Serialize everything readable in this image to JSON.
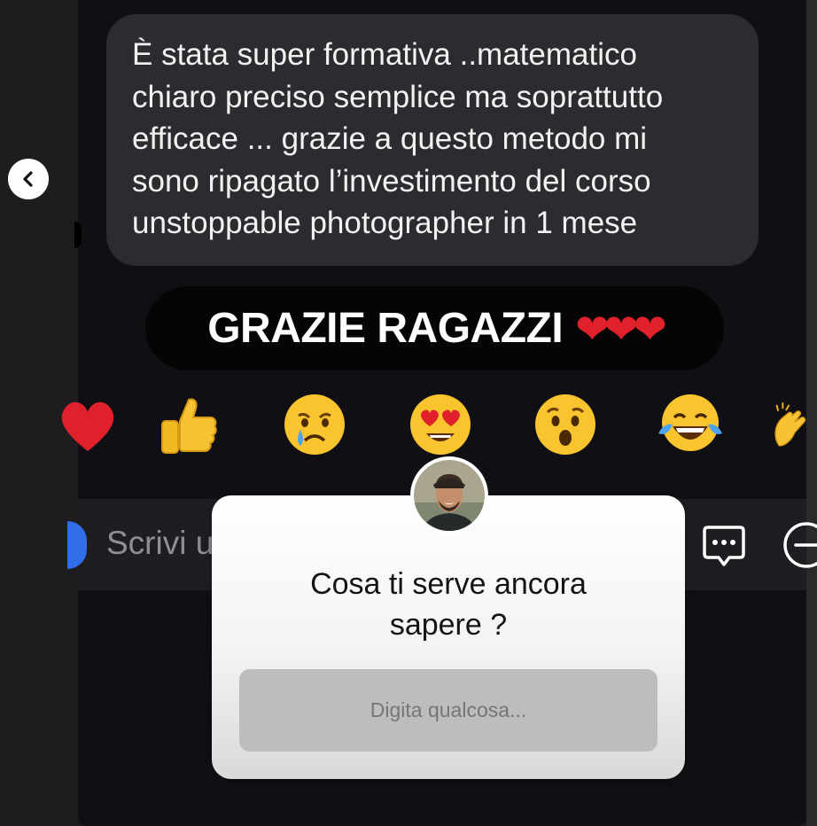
{
  "message": {
    "text": "È stata super formativa ..matematico\nchiaro preciso semplice ma soprattutto\nefficace ... grazie a questo metodo mi\nsono ripagato l’investimento del corso\nunstoppable photographer in 1 mese"
  },
  "thanks": {
    "text": "GRAZIE RAGAZZI",
    "hearts": "❤❤❤"
  },
  "reactions": [
    {
      "name": "heart",
      "icon": "heart-icon"
    },
    {
      "name": "thumbs-up",
      "icon": "thumbs-up-icon"
    },
    {
      "name": "crying-face",
      "icon": "crying-face-icon"
    },
    {
      "name": "heart-eyes-face",
      "icon": "heart-eyes-icon"
    },
    {
      "name": "surprised-face",
      "icon": "surprised-face-icon"
    },
    {
      "name": "tears-of-joy-face",
      "icon": "tears-of-joy-icon"
    },
    {
      "name": "clapping-hands",
      "icon": "clapping-hands-icon"
    }
  ],
  "compose": {
    "placeholder": "Scrivi u"
  },
  "question_sticker": {
    "question": "Cosa ti serve ancora\nsapere ?",
    "answer_placeholder": "Digita qualcosa..."
  },
  "colors": {
    "background": "#101014",
    "bubble": "#2c2c30",
    "accent_blue": "#2f6ee8",
    "heart_red": "#e0202a"
  }
}
